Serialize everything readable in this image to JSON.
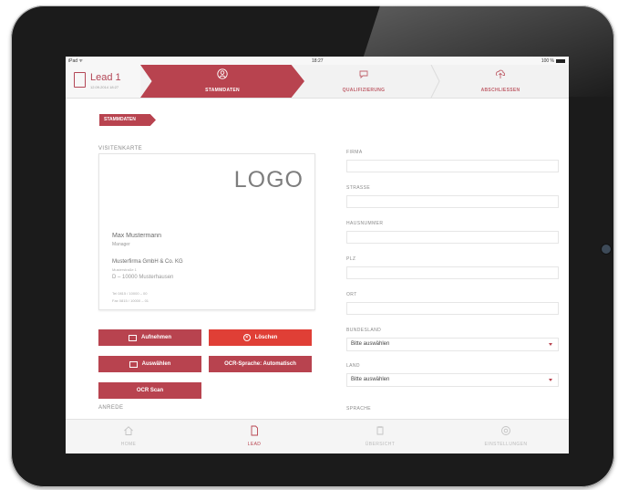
{
  "status_bar": {
    "carrier": "iPad ᯤ",
    "time": "18:27",
    "battery": "100 %"
  },
  "lead": {
    "title": "Lead 1",
    "date": "12.09.2014 18:27"
  },
  "steps": [
    {
      "label": "STAMMDATEN",
      "icon": "user-icon",
      "active": true
    },
    {
      "label": "QUALIFIZIERUNG",
      "icon": "chat-icon",
      "active": false
    },
    {
      "label": "ABSCHLIESSEN",
      "icon": "upload-icon",
      "active": false
    }
  ],
  "section_tag": "STAMMDATEN",
  "business_card": {
    "section_label": "VISITENKARTE",
    "logo_text": "LOGO",
    "name": "Max Mustermann",
    "role": "Manager",
    "company": "Musterfirma GmbH & Co. KG",
    "street": "Musterstraße 1",
    "city": "D – 10000 Musterhausen",
    "tel": "Tel   0815 / 10000 – 00",
    "fax": "Fax   0815 / 10000 – 01"
  },
  "buttons": {
    "capture": "Aufnehmen",
    "delete": "Löschen",
    "select": "Auswählen",
    "ocr_language": "OCR-Sprache: Automatisch",
    "ocr_scan": "OCR Scan"
  },
  "salutation_label": "ANREDE",
  "form": {
    "company": {
      "label": "FIRMA",
      "value": ""
    },
    "street": {
      "label": "STRASSE",
      "value": ""
    },
    "house_number": {
      "label": "HAUSNUMMER",
      "value": ""
    },
    "zip": {
      "label": "PLZ",
      "value": ""
    },
    "city": {
      "label": "ORT",
      "value": ""
    },
    "state": {
      "label": "BUNDESLAND",
      "value": "Bitte auswählen"
    },
    "country": {
      "label": "LAND",
      "value": "Bitte auswählen"
    },
    "language": {
      "label": "SPRACHE"
    }
  },
  "tabs": [
    {
      "label": "HOME",
      "icon": "home-icon",
      "active": false
    },
    {
      "label": "LEAD",
      "icon": "document-icon",
      "active": true
    },
    {
      "label": "ÜBERSICHT",
      "icon": "overview-icon",
      "active": false
    },
    {
      "label": "EINSTELLUNGEN",
      "icon": "gear-icon",
      "active": false
    }
  ],
  "colors": {
    "accent": "#b8434f",
    "delete": "#e03f36",
    "inactive_tab": "#bbbbbb"
  }
}
